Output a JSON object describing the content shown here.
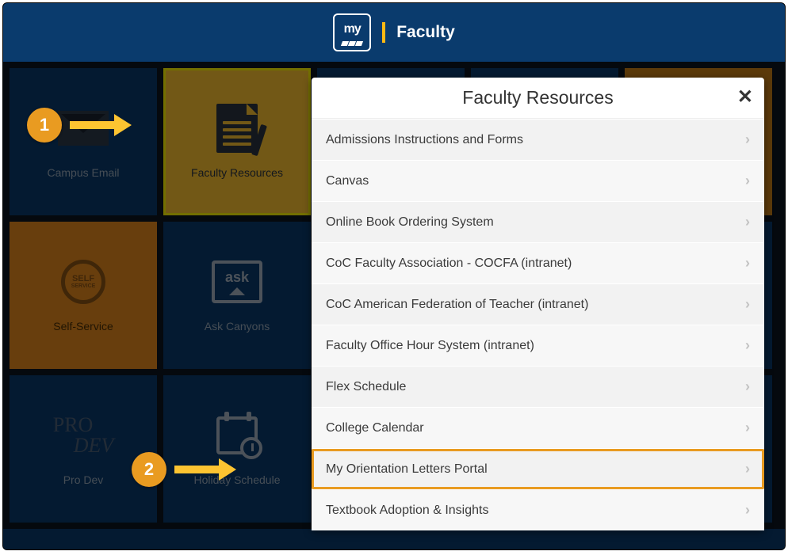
{
  "header": {
    "logo_text": "my",
    "title": "Faculty"
  },
  "tiles": [
    {
      "label": "Campus Email"
    },
    {
      "label": "Faculty Resources"
    },
    {
      "label": ""
    },
    {
      "label": ""
    },
    {
      "label": ""
    },
    {
      "label": "Self-Service"
    },
    {
      "label": "Ask Canyons"
    },
    {
      "label": ""
    },
    {
      "label": ""
    },
    {
      "label": ""
    },
    {
      "label": "Pro Dev"
    },
    {
      "label": "Holiday Schedule"
    },
    {
      "label": ""
    },
    {
      "label": ""
    },
    {
      "label": ""
    }
  ],
  "panel": {
    "title": "Faculty Resources",
    "items": [
      {
        "label": "Admissions Instructions and Forms",
        "highlighted": false
      },
      {
        "label": "Canvas",
        "highlighted": false
      },
      {
        "label": "Online Book Ordering System",
        "highlighted": false
      },
      {
        "label": "CoC Faculty Association - COCFA (intranet)",
        "highlighted": false
      },
      {
        "label": "CoC American Federation of Teacher (intranet)",
        "highlighted": false
      },
      {
        "label": "Faculty Office Hour System (intranet)",
        "highlighted": false
      },
      {
        "label": "Flex Schedule",
        "highlighted": false
      },
      {
        "label": "College Calendar",
        "highlighted": false
      },
      {
        "label": "My Orientation Letters Portal",
        "highlighted": true
      },
      {
        "label": "Textbook Adoption & Insights",
        "highlighted": false
      }
    ]
  },
  "steps": {
    "one": "1",
    "two": "2"
  },
  "self_label_top": "SELF",
  "self_label_bottom": "SERVICE",
  "ask_label": "ask",
  "prodev_l1": "PRO",
  "prodev_l2": "DEV"
}
